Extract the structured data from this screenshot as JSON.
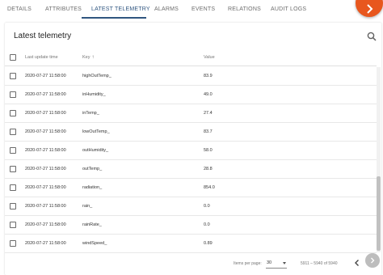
{
  "tabs": [
    {
      "label": "DETAILS",
      "active": false
    },
    {
      "label": "ATTRIBUTES",
      "active": false
    },
    {
      "label": "LATEST TELEMETRY",
      "active": true
    },
    {
      "label": "ALARMS",
      "active": false
    },
    {
      "label": "EVENTS",
      "active": false
    },
    {
      "label": "RELATIONS",
      "active": false
    },
    {
      "label": "AUDIT LOGS",
      "active": false
    }
  ],
  "card": {
    "title": "Latest telemetry",
    "search_icon": "search-icon"
  },
  "table": {
    "headers": {
      "last_update_time": "Last update time",
      "key": "Key",
      "key_sort_icon": "arrow-up-icon",
      "value": "Value"
    },
    "rows": [
      {
        "time": "2020-07-27 11:58:00",
        "key": "highOutTemp_",
        "value": "83.9"
      },
      {
        "time": "2020-07-27 11:58:00",
        "key": "inHumidity_",
        "value": "49.0"
      },
      {
        "time": "2020-07-27 11:58:00",
        "key": "inTemp_",
        "value": "27.4"
      },
      {
        "time": "2020-07-27 11:58:00",
        "key": "lowOutTemp_",
        "value": "83.7"
      },
      {
        "time": "2020-07-27 11:58:00",
        "key": "outHumidity_",
        "value": "58.0"
      },
      {
        "time": "2020-07-27 11:58:00",
        "key": "outTemp_",
        "value": "28.8"
      },
      {
        "time": "2020-07-27 11:58:00",
        "key": "radiation_",
        "value": "854.0"
      },
      {
        "time": "2020-07-27 11:58:00",
        "key": "rain_",
        "value": "0.0"
      },
      {
        "time": "2020-07-27 11:58:00",
        "key": "rainRate_",
        "value": "0.0"
      },
      {
        "time": "2020-07-27 11:58:00",
        "key": "windSpeed_",
        "value": "0.89"
      }
    ]
  },
  "paginator": {
    "items_per_page_label": "Items per page:",
    "items_per_page_value": "30",
    "range_label": "5911 – 5940 of 5940",
    "prev_icon": "chevron-left-icon",
    "next_icon": "chevron-right-icon"
  },
  "colors": {
    "accent": "#305680",
    "fab": "#e8571e"
  }
}
